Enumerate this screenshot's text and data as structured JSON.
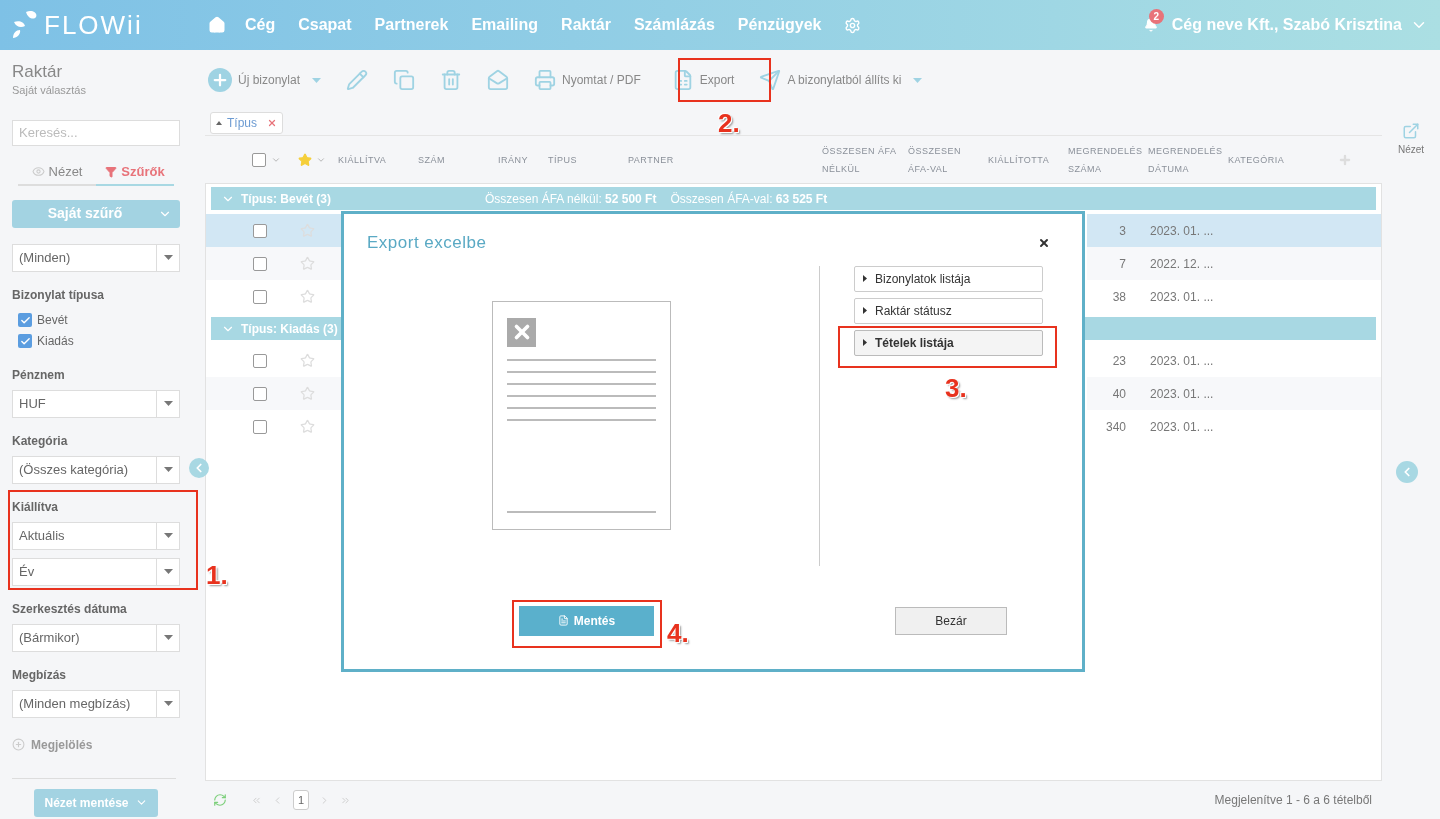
{
  "nav": {
    "logo": "FLOWii",
    "items": [
      "Cég",
      "Csapat",
      "Partnerek",
      "Emailing",
      "Raktár",
      "Számlázás",
      "Pénzügyek"
    ],
    "notifications": "2",
    "user": "Cég neve Kft., Szabó Krisztina"
  },
  "sidebar": {
    "title": "Raktár",
    "subtitle": "Saját választás",
    "search": {
      "placeholder": "Keresés..."
    },
    "tabs": [
      {
        "label": "Nézet",
        "selected": false
      },
      {
        "label": "Szűrők",
        "selected": true
      }
    ],
    "filter_button": "Saját szűrő",
    "sections": [
      {
        "kind": "select",
        "selects": [
          "(Minden)"
        ]
      },
      {
        "kind": "checkboxes",
        "label": "Bizonylat típusa",
        "options": [
          {
            "label": "Bevét",
            "checked": true
          },
          {
            "label": "Kiadás",
            "checked": true
          }
        ]
      },
      {
        "kind": "select",
        "label": "Pénznem",
        "selects": [
          "HUF"
        ]
      },
      {
        "kind": "select",
        "label": "Kategória",
        "selects": [
          "(Összes kategória)"
        ]
      },
      {
        "kind": "select",
        "label": "Kiállítva",
        "selects": [
          "Aktuális",
          "Év"
        ]
      },
      {
        "kind": "select",
        "label": "Szerkesztés dátuma",
        "selects": [
          "(Bármikor)"
        ]
      },
      {
        "kind": "select",
        "label": "Megbízás",
        "selects": [
          "(Minden megbízás)"
        ]
      }
    ],
    "add_link": "Megjelölés",
    "save_button": "Nézet mentése"
  },
  "toolbar": [
    {
      "kind": "new",
      "label": "Új bizonylat",
      "menu": true
    },
    {
      "kind": "edit",
      "menu": false
    },
    {
      "kind": "copy",
      "menu": false
    },
    {
      "kind": "delete",
      "menu": false
    },
    {
      "kind": "mail",
      "menu": false
    },
    {
      "kind": "print",
      "label": "Nyomtat / PDF",
      "menu": false
    },
    {
      "kind": "export",
      "label": "Export",
      "menu": false
    },
    {
      "kind": "issue",
      "label": "A bizonylatból állíts ki",
      "menu": true
    }
  ],
  "filter_chip": "Típus",
  "table": {
    "select_all": {
      "checked": false
    },
    "columns": [
      "KIÁLLÍTVA",
      "SZÁM",
      "IRÁNY",
      "TÍPUS",
      "PARTNER",
      "ÖSSZESEN ÁFA NÉLKÜL",
      "ÖSSZESEN ÁFA-VAL",
      "KIÁLLÍTOTTA",
      "MEGRENDELÉS SZÁMA",
      "MEGRENDELÉS DÁTUMA",
      "KATEGÓRIA"
    ],
    "groups": [
      {
        "label": "Típus: Bevét (3)",
        "expanded": true,
        "totals": [
          "Összesen ÁFA nélkül: **52 500 Ft**",
          "Összesen ÁFA-val: **63 525 Ft**"
        ],
        "rows": [
          {
            "selected": true,
            "checked": false,
            "starred": false,
            "order_number": "3",
            "order_date": "2023. 01. ..."
          },
          {
            "selected": false,
            "checked": false,
            "starred": false,
            "order_number": "7",
            "order_date": "2022. 12. ..."
          },
          {
            "selected": false,
            "checked": false,
            "starred": false,
            "order_number": "38",
            "order_date": "2023. 01. ..."
          }
        ]
      },
      {
        "label": "Típus: Kiadás (3)",
        "expanded": true,
        "rows": [
          {
            "selected": false,
            "checked": false,
            "starred": false,
            "order_number": "23",
            "order_date": "2023. 01. ..."
          },
          {
            "selected": false,
            "checked": false,
            "starred": false,
            "order_number": "40",
            "order_date": "2023. 01. ..."
          },
          {
            "selected": false,
            "checked": false,
            "starred": false,
            "order_number": "340",
            "order_date": "2023. 01. ..."
          }
        ]
      }
    ]
  },
  "pagination": {
    "page": "1",
    "summary": "Megjelenítve 1 - 6 a 6 tételből"
  },
  "right_rail": {
    "label": "Nézet"
  },
  "dialog": {
    "title": "Export excelbe",
    "options": [
      {
        "label": "Bizonylatok listája",
        "selected": false
      },
      {
        "label": "Raktár státusz",
        "selected": false
      },
      {
        "label": "Tételek listája",
        "selected": true
      }
    ],
    "save_button": "Mentés",
    "close_button": "Bezár"
  },
  "annotations": [
    "1.",
    "2.",
    "3.",
    "4."
  ]
}
